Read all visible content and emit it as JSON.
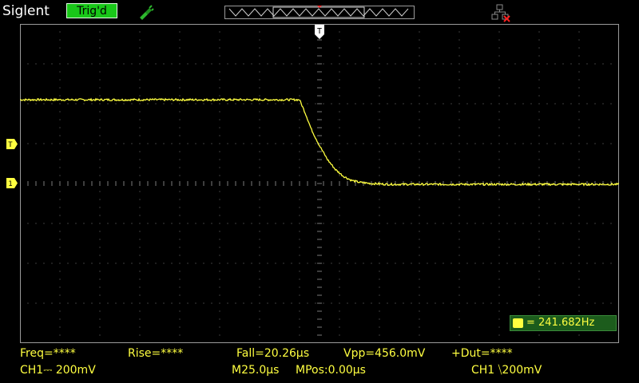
{
  "header": {
    "brand": "Siglent",
    "trigger_status": "Trig'd"
  },
  "status_bar_icons": [
    "usb-probe-icon",
    "network-disconnected-icon"
  ],
  "colors": {
    "background": "#000000",
    "grid": "#7a7a7a",
    "trace": "#ffff40",
    "trig_badge": "#19c819",
    "freq_box": "#1c5c1c"
  },
  "markers": {
    "trigger_top": "T",
    "trigger_level": "T",
    "channel1": "1"
  },
  "frequency_counter": {
    "value": "= 241.682Hz"
  },
  "measurements": {
    "freq": "Freq=****",
    "rise": "Rise=****",
    "fall": "Fall=20.26µs",
    "vpp": "Vpp=456.0mV",
    "duty": "+Dut=****"
  },
  "channel_info": {
    "ch1": "CH1⎓ 200mV",
    "timebase": "M25.0µs",
    "mpos": "MPos:0.00µs",
    "trigger": "CH1 ⧹200mV"
  },
  "chart_data": {
    "type": "line",
    "grid_divisions": {
      "x": 15,
      "y": 8
    },
    "series": [
      {
        "x_div": [
          0,
          7.0,
          7.15,
          7.3,
          7.5,
          7.7,
          7.9,
          8.1,
          8.3,
          8.5,
          8.8,
          9.2,
          10,
          12,
          15
        ],
        "y_div": [
          2.1,
          2.1,
          1.75,
          1.35,
          0.95,
          0.6,
          0.35,
          0.18,
          0.08,
          0.03,
          0.0,
          -0.02,
          -0.02,
          -0.02,
          -0.02
        ]
      }
    ]
  }
}
